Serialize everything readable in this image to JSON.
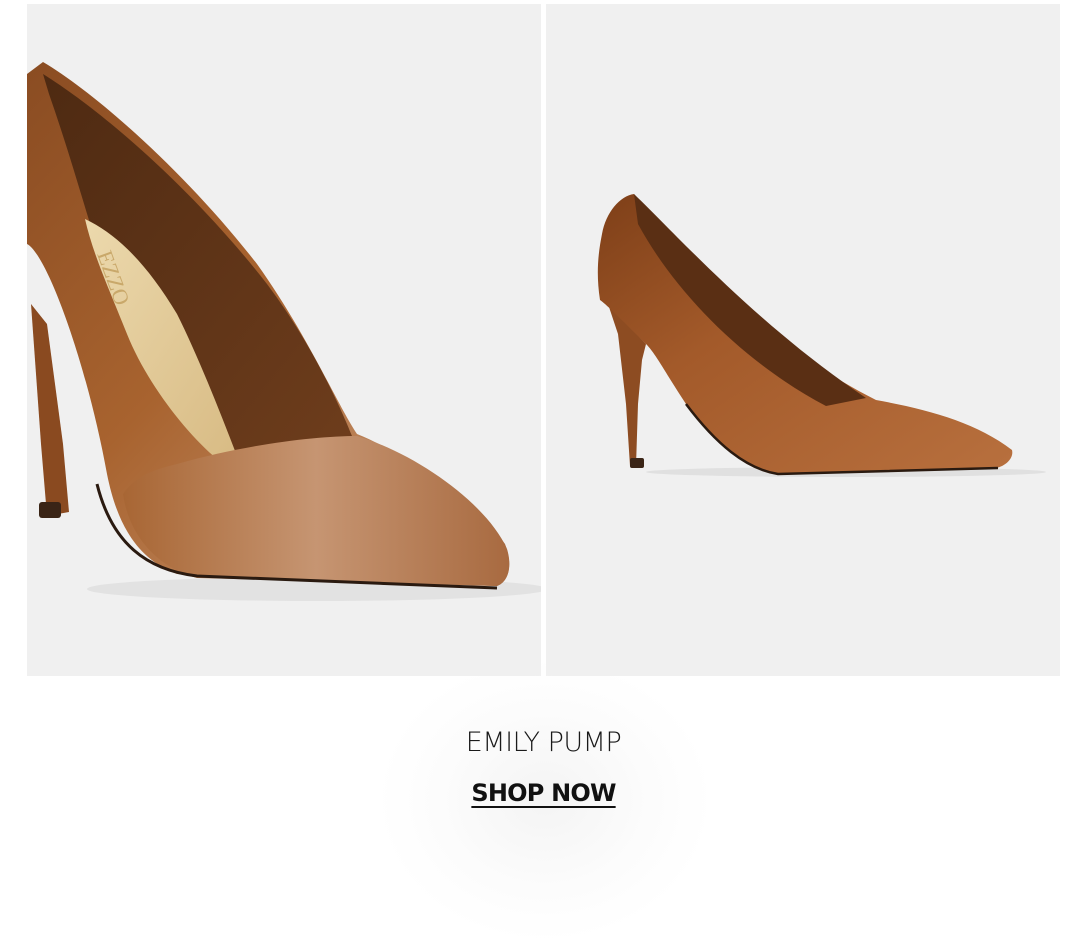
{
  "product": {
    "name": "EMILY PUMP",
    "cta_label": "SHOP NOW",
    "insole_logo_text": "EZZO"
  },
  "images": [
    {
      "name": "product-image-closeup",
      "description_icon": "shoe-closeup-image"
    },
    {
      "name": "product-image-side",
      "description_icon": "shoe-side-image"
    }
  ],
  "colors": {
    "panel_background": "#f0f0f0",
    "leather": "#a4602e",
    "insole": "#e6cf9e",
    "text": "#111111"
  }
}
